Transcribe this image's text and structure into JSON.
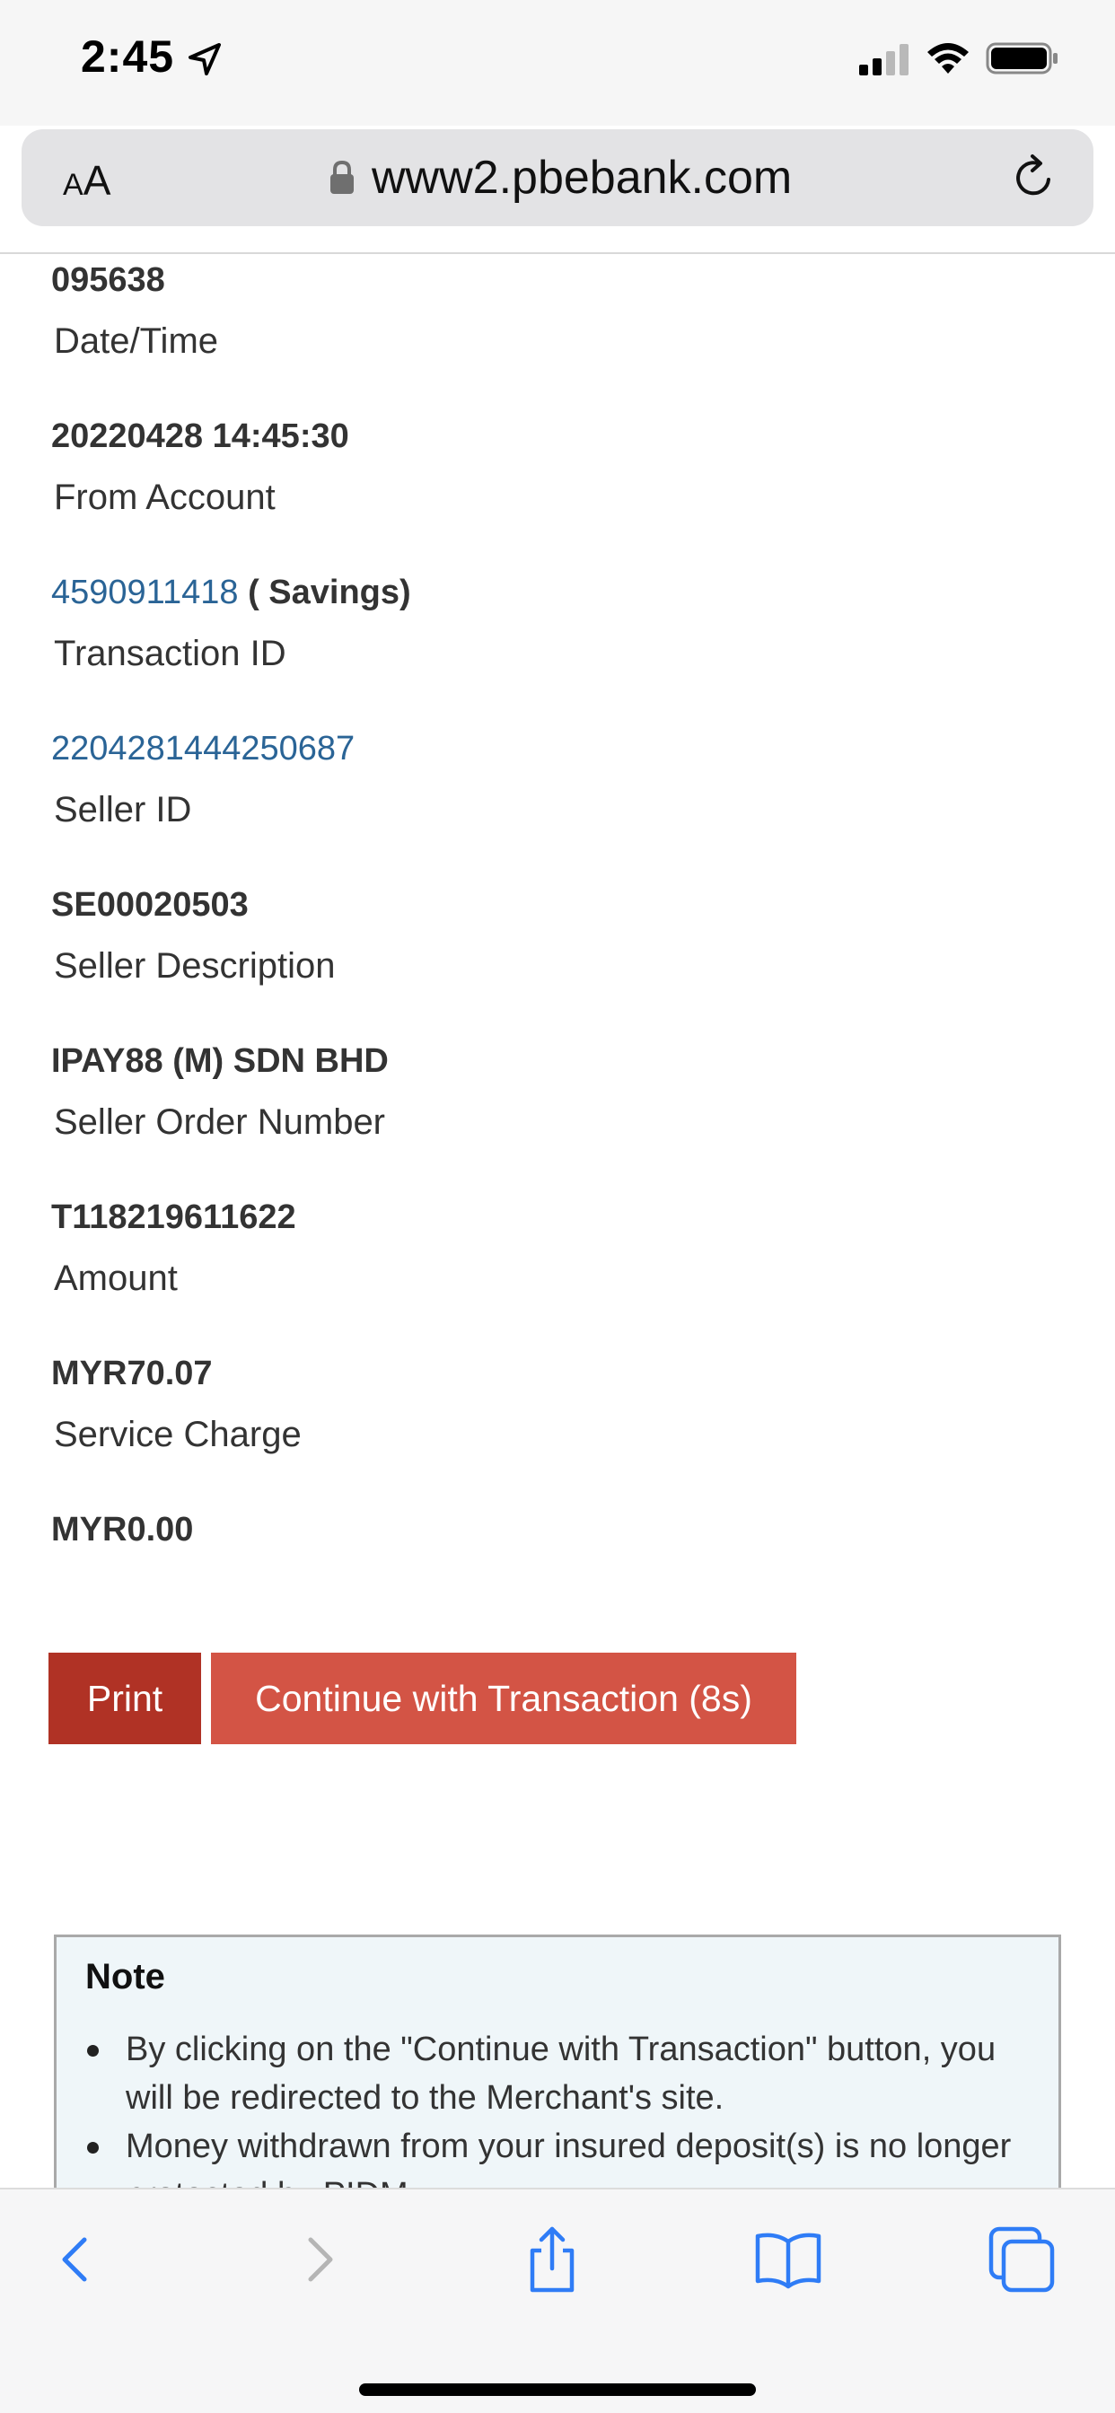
{
  "status_bar": {
    "time": "2:45"
  },
  "browser": {
    "text_size_label_small": "A",
    "text_size_label_large": "A",
    "url": "www2.pbebank.com"
  },
  "receipt": {
    "approval_code_value": "095638",
    "datetime_label": "Date/Time",
    "datetime_value": "20220428 14:45:30",
    "from_account_label": "From Account",
    "from_account_number": "4590911418",
    "from_account_type": " ( Savings)",
    "transaction_id_label": "Transaction ID",
    "transaction_id_value": "2204281444250687",
    "seller_id_label": "Seller ID",
    "seller_id_value": "SE00020503",
    "seller_description_label": "Seller Description",
    "seller_description_value": "IPAY88 (M) SDN BHD",
    "seller_order_label": "Seller Order Number",
    "seller_order_value": "T118219611622",
    "amount_label": "Amount",
    "amount_value": "MYR70.07",
    "service_charge_label": "Service Charge",
    "service_charge_value": "MYR0.00"
  },
  "actions": {
    "print_label": "Print",
    "continue_label": "Continue with Transaction (8s)"
  },
  "note": {
    "title": "Note",
    "items": [
      "By clicking on the \"Continue with Transaction\" button, you will be redirected to the Merchant's site.",
      "Money withdrawn from your insured deposit(s) is no longer protected by PIDM."
    ]
  },
  "colors": {
    "print_button": "#b03225",
    "continue_button": "#d35445",
    "link": "#2a6496",
    "ios_blue": "#2f7cf6"
  },
  "icons": {
    "location": "location-arrow-icon",
    "signal": "cellular-signal-icon",
    "wifi": "wifi-icon",
    "battery": "battery-icon",
    "lock": "lock-icon",
    "reload": "reload-icon",
    "back": "back-chevron-icon",
    "forward": "forward-chevron-icon",
    "share": "share-icon",
    "bookmarks": "bookmarks-book-icon",
    "tabs": "tabs-icon"
  }
}
